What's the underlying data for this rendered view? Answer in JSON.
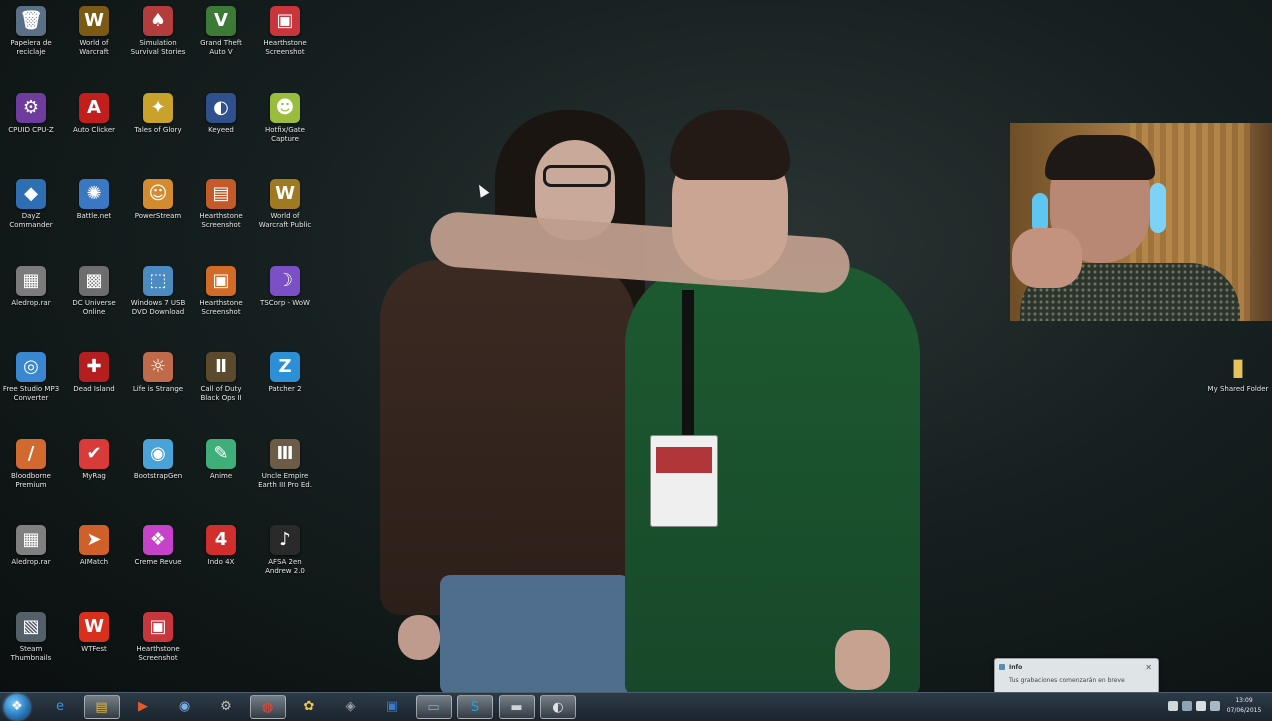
{
  "desktop": {
    "icons": [
      {
        "label": "Papelera de reciclaje",
        "icon": "recycle-bin-icon",
        "color": "#5b6f86",
        "glyph": "🗑"
      },
      {
        "label": "World of Warcraft",
        "icon": "wow-icon",
        "color": "#7b5a16",
        "glyph": "W"
      },
      {
        "label": "Simulation Survival Stories",
        "icon": "app-icon",
        "color": "#b33c3c",
        "glyph": "♠"
      },
      {
        "label": "Grand Theft Auto V",
        "icon": "gta-icon",
        "color": "#3d7a38",
        "glyph": "V"
      },
      {
        "label": "Hearthstone Screenshot",
        "icon": "image-icon",
        "color": "#c9353d",
        "glyph": "▣"
      },
      {
        "label": "CPUID CPU-Z",
        "icon": "cpuz-icon",
        "color": "#6e3c9d",
        "glyph": "⚙"
      },
      {
        "label": "Auto Clicker",
        "icon": "autoclicker-icon",
        "color": "#c31e1e",
        "glyph": "A"
      },
      {
        "label": "Tales of Glory",
        "icon": "game-icon",
        "color": "#c8a22b",
        "glyph": "✦"
      },
      {
        "label": "Keyeed",
        "icon": "app-icon",
        "color": "#2f4f8d",
        "glyph": "◐"
      },
      {
        "label": "Hotfix/Gate Capture",
        "icon": "capture-icon",
        "color": "#9bbd3e",
        "glyph": "☻"
      },
      {
        "label": "DayZ Commander",
        "icon": "dayz-icon",
        "color": "#2e6fb4",
        "glyph": "◆"
      },
      {
        "label": "Battle.net",
        "icon": "battlenet-icon",
        "color": "#3a78c3",
        "glyph": "✺"
      },
      {
        "label": "PowerStream",
        "icon": "app-icon",
        "color": "#d48a2f",
        "glyph": "☺"
      },
      {
        "label": "Hearthstone Screenshot",
        "icon": "image-icon",
        "color": "#c45a2a",
        "glyph": "▤"
      },
      {
        "label": "World of Warcraft Public",
        "icon": "wow-icon",
        "color": "#a07a23",
        "glyph": "W"
      },
      {
        "label": "Aledrop.rar",
        "icon": "archive-icon",
        "color": "#7b7b7b",
        "glyph": "▦"
      },
      {
        "label": "DC Universe Online",
        "icon": "game-icon",
        "color": "#6d6d6d",
        "glyph": "▩"
      },
      {
        "label": "Windows 7 USB DVD Download",
        "icon": "usb-icon",
        "color": "#4b8bc2",
        "glyph": "⬚"
      },
      {
        "label": "Hearthstone Screenshot",
        "icon": "image-icon",
        "color": "#d36b28",
        "glyph": "▣"
      },
      {
        "label": "TSCorp - WoW",
        "icon": "app-icon",
        "color": "#7b4fc6",
        "glyph": "☽"
      },
      {
        "label": "Free Studio MP3 Converter",
        "icon": "converter-icon",
        "color": "#3a87d1",
        "glyph": "◎"
      },
      {
        "label": "Dead Island",
        "icon": "game-icon",
        "color": "#b51e1e",
        "glyph": "✚"
      },
      {
        "label": "Life is Strange",
        "icon": "game-icon",
        "color": "#c06a4c",
        "glyph": "☼"
      },
      {
        "label": "Call of Duty Black Ops II",
        "icon": "cod-icon",
        "color": "#5c4a2f",
        "glyph": "Ⅱ"
      },
      {
        "label": "Patcher 2",
        "icon": "app-icon",
        "color": "#2d8fd5",
        "glyph": "Z"
      },
      {
        "label": "Bloodborne Premium",
        "icon": "app-icon",
        "color": "#d2692e",
        "glyph": "/"
      },
      {
        "label": "MyRag",
        "icon": "app-icon",
        "color": "#d93a3a",
        "glyph": "✔"
      },
      {
        "label": "BootstrapGen",
        "icon": "app-icon",
        "color": "#4aa3d8",
        "glyph": "◉"
      },
      {
        "label": "Anime",
        "icon": "app-icon",
        "color": "#3fae7a",
        "glyph": "✎"
      },
      {
        "label": "Uncle Empire Earth III Pro Ed.",
        "icon": "game-icon",
        "color": "#6b5b47",
        "glyph": "Ⅲ"
      },
      {
        "label": "Aledrop.rar",
        "icon": "archive-icon",
        "color": "#808080",
        "glyph": "▦"
      },
      {
        "label": "AIMatch",
        "icon": "app-icon",
        "color": "#d0602a",
        "glyph": "➤"
      },
      {
        "label": "Creme Revue",
        "icon": "app-icon",
        "color": "#c642c9",
        "glyph": "❖"
      },
      {
        "label": "Indo 4X",
        "icon": "app-icon",
        "color": "#d12e2e",
        "glyph": "4"
      },
      {
        "label": "AFSA 2en Andrew 2.0",
        "icon": "app-icon",
        "color": "#2a2a2a",
        "glyph": "♪"
      },
      {
        "label": "Steam Thumbnails",
        "icon": "app-icon",
        "color": "#555f6a",
        "glyph": "▧"
      },
      {
        "label": "WTFest",
        "icon": "app-icon",
        "color": "#d9301e",
        "glyph": "W"
      },
      {
        "label": "Hearthstone Screenshot",
        "icon": "image-icon",
        "color": "#c9353d",
        "glyph": "▣"
      }
    ],
    "right_icon": {
      "label": "My Shared Folder",
      "icon": "folder-icon",
      "color": "#e6c35a",
      "glyph": "▮"
    }
  },
  "notification": {
    "title": "Info",
    "body": "Tus grabaciones comenzarán en breve",
    "close_label": "✕"
  },
  "taskbar": {
    "start_glyph": "❖",
    "items": [
      {
        "name": "ie-icon",
        "glyph": "e",
        "color": "#3b8fe0",
        "active": false
      },
      {
        "name": "explorer-icon",
        "glyph": "▤",
        "color": "#e1b84a",
        "active": true
      },
      {
        "name": "media-icon",
        "glyph": "▶",
        "color": "#e05a2b",
        "active": false
      },
      {
        "name": "network-icon",
        "glyph": "◉",
        "color": "#7fb0e0",
        "active": false
      },
      {
        "name": "tools-icon",
        "glyph": "⚙",
        "color": "#bfbfbf",
        "active": false
      },
      {
        "name": "chrome-icon",
        "glyph": "◍",
        "color": "#e04a3a",
        "active": true
      },
      {
        "name": "folder-icon",
        "glyph": "✿",
        "color": "#f2c84a",
        "active": false
      },
      {
        "name": "app-icon",
        "glyph": "◈",
        "color": "#9aa0a8",
        "active": false
      },
      {
        "name": "app2-icon",
        "glyph": "▣",
        "color": "#3a7ac8",
        "active": false
      },
      {
        "name": "monitor-icon",
        "glyph": "▭",
        "color": "#6ab4e6",
        "active": true
      },
      {
        "name": "skype-icon",
        "glyph": "S",
        "color": "#12a8e8",
        "active": true
      },
      {
        "name": "screen-icon",
        "glyph": "▬",
        "color": "#cfd3d8",
        "active": true
      },
      {
        "name": "record-icon",
        "glyph": "◐",
        "color": "#e2e2e2",
        "active": true
      }
    ],
    "clock_time": "13:09",
    "clock_date": "07/06/2015"
  },
  "colors": {
    "taskbar": "#1b242d",
    "wallpaper": "#162020",
    "icon_text": "#e8e8e8"
  }
}
